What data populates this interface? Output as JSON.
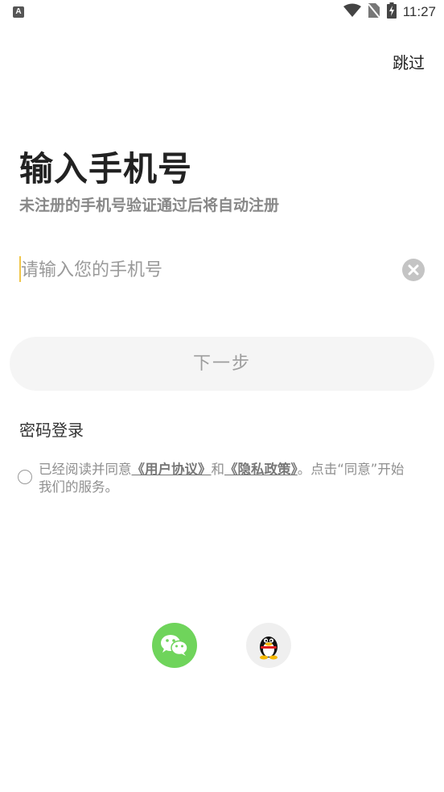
{
  "status_bar": {
    "app_icon_letter": "A",
    "time": "11:27",
    "icons": [
      "wifi-icon",
      "no-sim-icon",
      "battery-charging-icon"
    ]
  },
  "header": {
    "skip_label": "跳过"
  },
  "main": {
    "title": "输入手机号",
    "subtitle": "未注册的手机号验证通过后将自动注册",
    "phone_input": {
      "placeholder": "请输入您的手机号",
      "value": ""
    },
    "next_button_label": "下一步",
    "password_login_label": "密码登录"
  },
  "agreement": {
    "prefix": "已经阅读并同意",
    "user_agreement": "《用户协议》",
    "and": "和",
    "privacy_policy": "《隐私政策》",
    "suffix_line1": "。点击“同意”开始",
    "line2": "我们的服务。"
  },
  "social_login": [
    {
      "name": "wechat",
      "icon": "wechat-icon",
      "color": "#6fd45b"
    },
    {
      "name": "qq",
      "icon": "qq-penguin-icon",
      "color": "#efefef"
    }
  ],
  "colors": {
    "accent_cursor": "#f0c64a",
    "button_bg": "#f5f5f5",
    "button_text": "#9d9d9d"
  }
}
